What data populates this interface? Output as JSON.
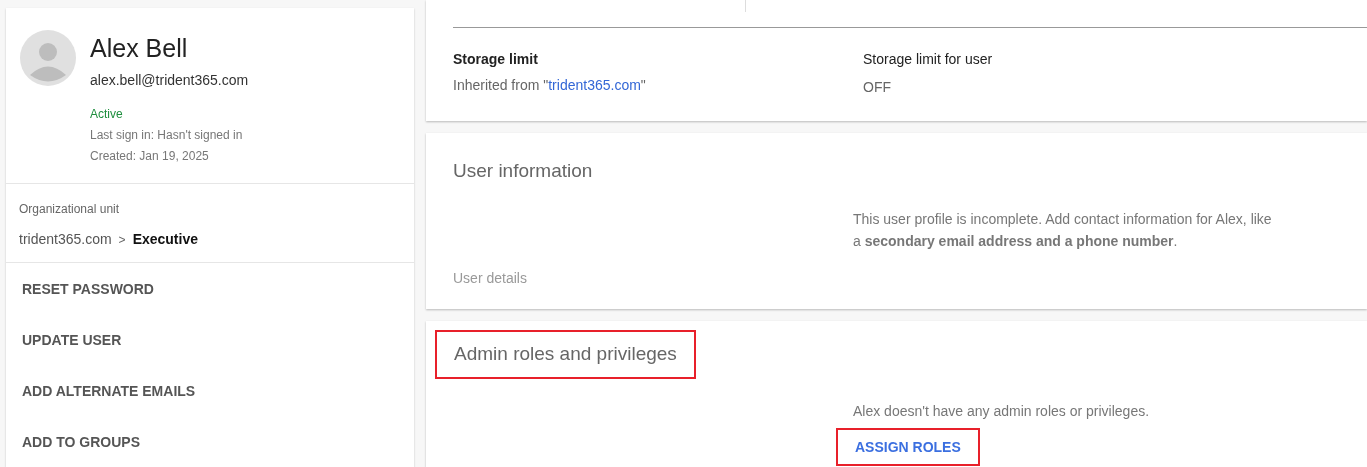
{
  "user": {
    "name": "Alex Bell",
    "email": "alex.bell@trident365.com",
    "status": "Active",
    "last_sign_in": "Last sign in: Hasn't signed in",
    "created": "Created: Jan 19, 2025"
  },
  "org_unit": {
    "label": "Organizational unit",
    "parent": "trident365.com",
    "separator": ">",
    "current": "Executive"
  },
  "actions": [
    "RESET PASSWORD",
    "UPDATE USER",
    "ADD ALTERNATE EMAILS",
    "ADD TO GROUPS"
  ],
  "storage": {
    "limit_label": "Storage limit",
    "inherited_prefix": "Inherited from \"",
    "inherited_link": "trident365.com",
    "inherited_suffix": "\"",
    "user_limit_label": "Storage limit for user",
    "user_limit_value": "OFF"
  },
  "user_information": {
    "title": "User information",
    "message": "This user profile is incomplete. Add contact information for Alex, like a **secondary email address and a phone number**.",
    "details_link": "User details"
  },
  "admin_roles": {
    "title": "Admin roles and privileges",
    "title_highlighted": true,
    "message": "Alex doesn't have any admin roles or privileges.",
    "button": "ASSIGN ROLES",
    "button_highlighted": true
  }
}
